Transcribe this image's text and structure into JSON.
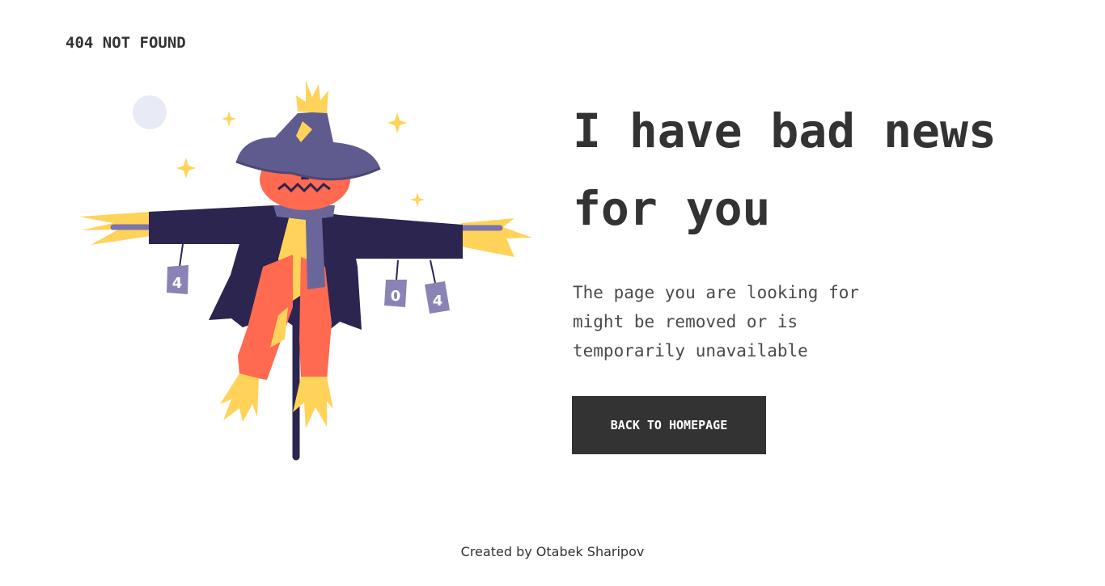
{
  "header": {
    "brand": "404 NOT FOUND"
  },
  "main": {
    "headline": "I have bad news for you",
    "description": "The page you are looking for might be removed or is temporarily unavailable",
    "button_label": "BACK TO HOMEPAGE"
  },
  "illustration": {
    "subject": "scarecrow-illustration",
    "can_labels": [
      "4",
      "0",
      "4"
    ]
  },
  "footer": {
    "credit": "Created by Otabek Sharipov"
  },
  "colors": {
    "text": "#333333",
    "button_bg": "#333333",
    "button_text": "#ffffff",
    "hat": "#5f5b8f",
    "coat": "#2b2550",
    "face": "#ff6a50",
    "straw": "#ffd35a",
    "can": "#8a83b5",
    "moon": "#e8ebf5"
  }
}
